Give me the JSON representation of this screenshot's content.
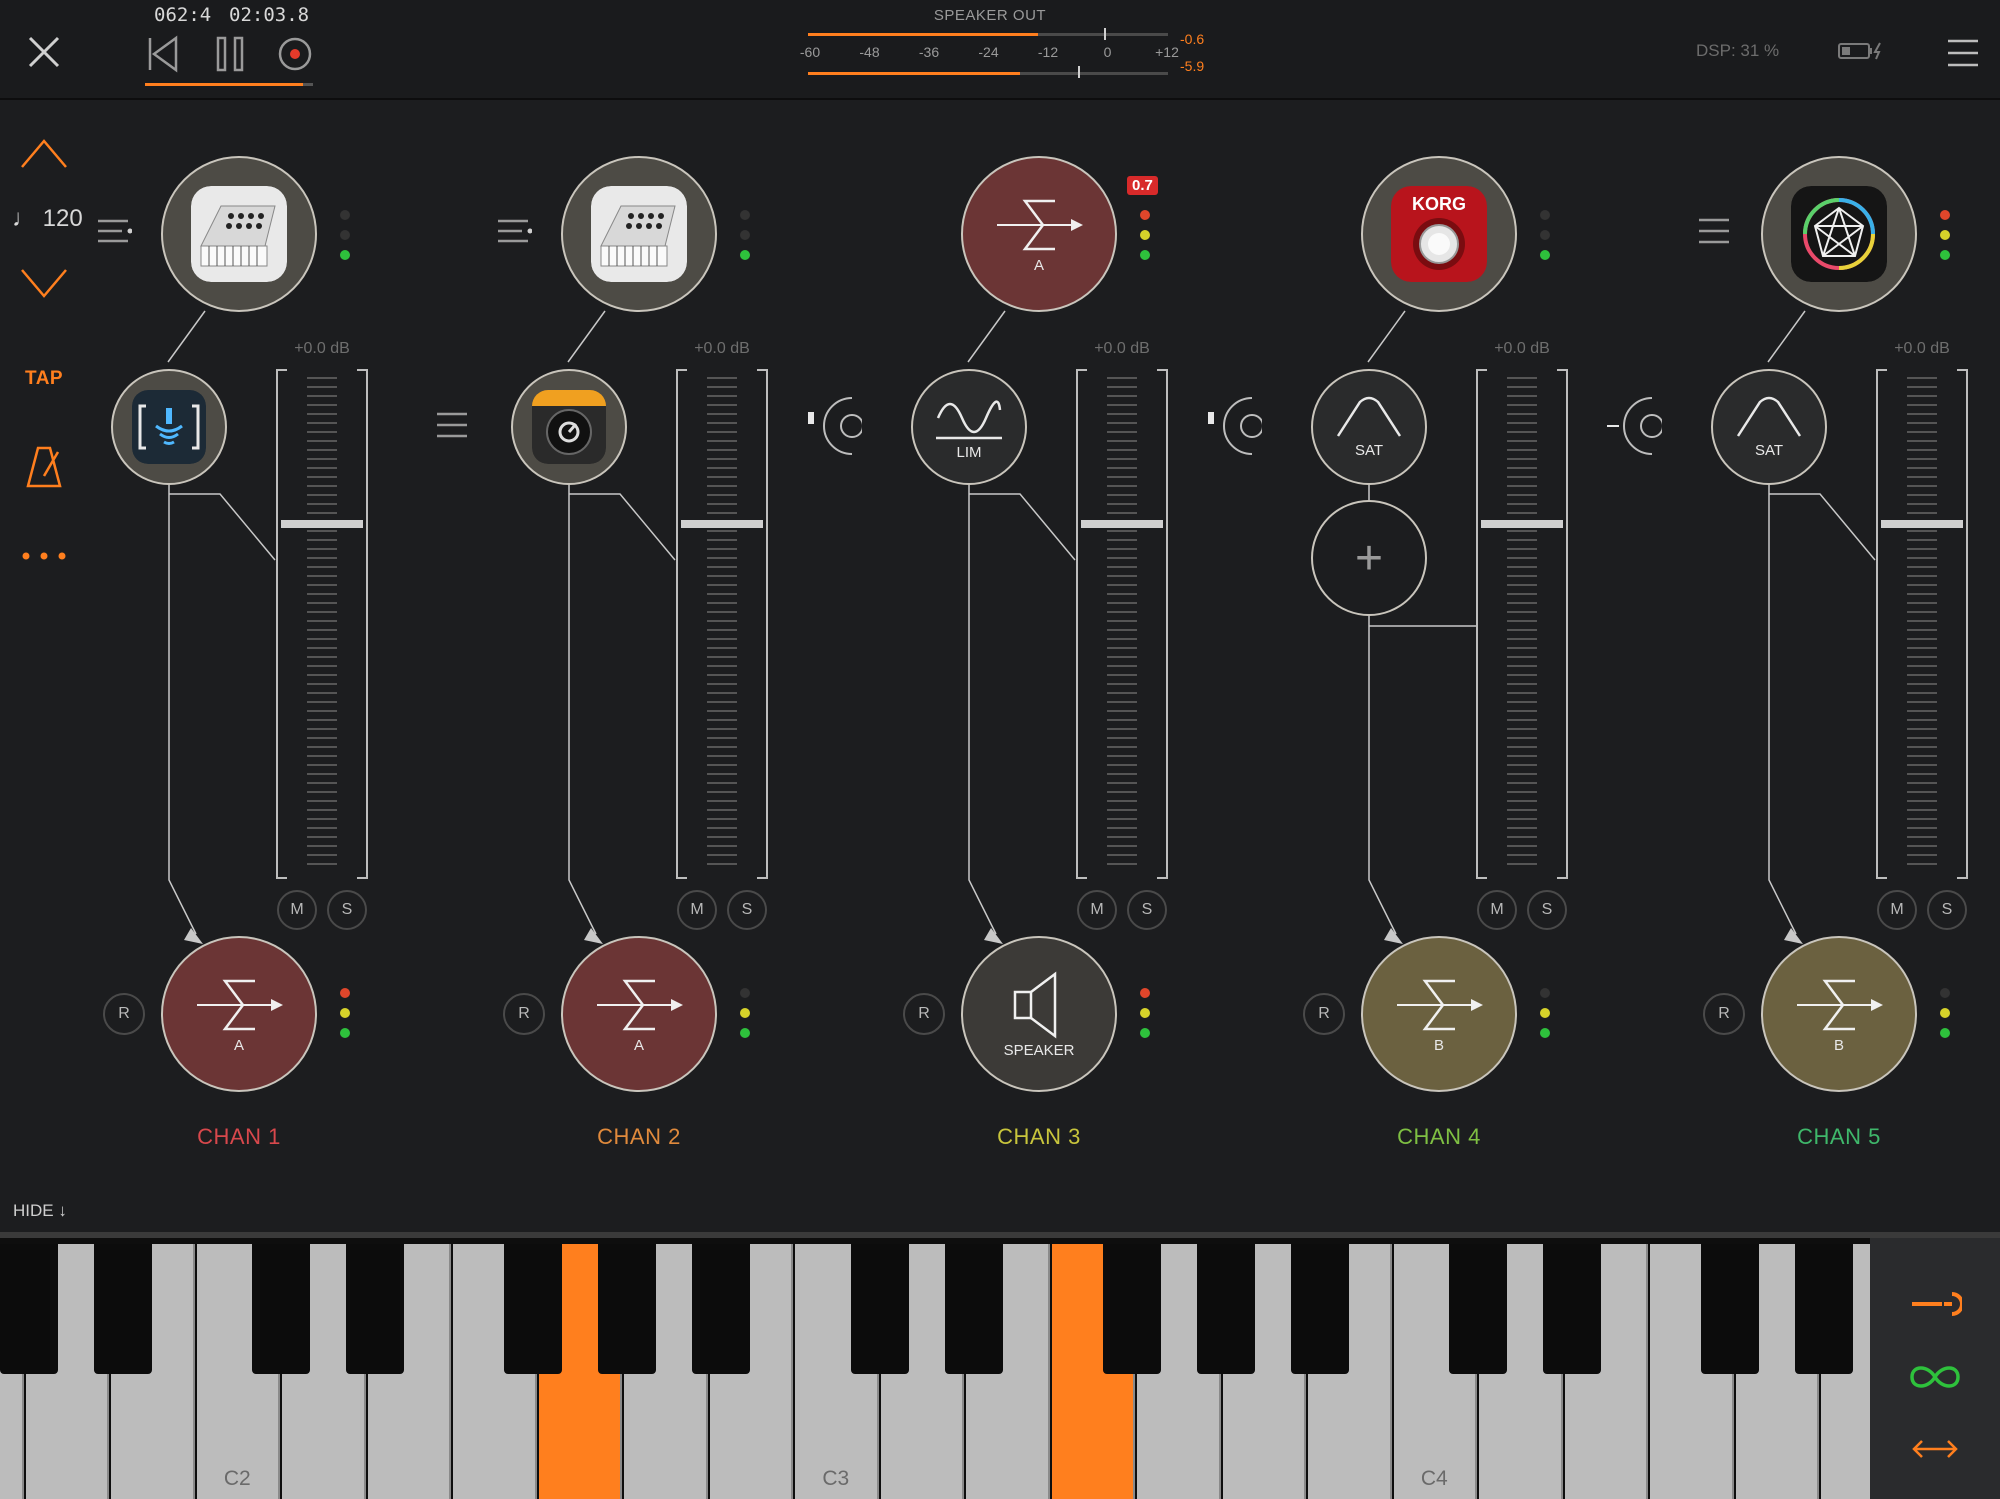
{
  "transport": {
    "position": "062:4",
    "time": "02:03.8"
  },
  "speaker_out": {
    "label": "SPEAKER OUT",
    "ticks": [
      "-60",
      "-48",
      "-36",
      "-24",
      "-12",
      "0",
      "+12"
    ],
    "peak_top": "-0.6",
    "peak_bottom": "-5.9",
    "level_top": 0.64,
    "level_bottom": 0.59
  },
  "dsp": "DSP: 31 %",
  "sidebar": {
    "tempo": "♩ 120",
    "tap": "TAP"
  },
  "hide_label": "HIDE ↓",
  "colors": {
    "accent": "#ff7f1e",
    "bus_a": "#6b3535",
    "bus_b": "#6b6140",
    "speaker": "#3c3a37",
    "node_fill": "#4d4b45",
    "led_red": "#e0462b",
    "led_yellow": "#d6d22a",
    "led_green": "#2ec13c"
  },
  "channels": [
    {
      "name": "CHAN 1",
      "color": "#d8484c",
      "source_icon": "synth-keyboard-icon",
      "fx": {
        "icon": "wave-bracket-icon",
        "label": ""
      },
      "db": "+0.0 dB",
      "bus": {
        "type": "sum",
        "label": "A"
      },
      "mute": "M",
      "solo": "S",
      "rec": "R"
    },
    {
      "name": "CHAN 2",
      "color": "#e08a3c",
      "source_icon": "synth-keyboard-icon",
      "fx": {
        "icon": "pedal-knob-icon",
        "label": ""
      },
      "db": "+0.0 dB",
      "bus": {
        "type": "sum",
        "label": "A"
      },
      "mute": "M",
      "solo": "S",
      "rec": "R"
    },
    {
      "name": "CHAN 3",
      "color": "#c8c53c",
      "source_icon": "sum-icon",
      "source_label": "A",
      "badge": "0.7",
      "fx": {
        "icon": "limiter-icon",
        "label": "LIM"
      },
      "db": "+0.0 dB",
      "bus": {
        "type": "speaker",
        "label": "SPEAKER"
      },
      "mute": "M",
      "solo": "S",
      "rec": "R"
    },
    {
      "name": "CHAN 4",
      "color": "#7fc043",
      "source_icon": "korg-knob-icon",
      "source_text": "KORG",
      "fx": {
        "icon": "saturation-icon",
        "label": "SAT"
      },
      "add": "+",
      "db": "+0.0 dB",
      "bus": {
        "type": "sum",
        "label": "B"
      },
      "mute": "M",
      "solo": "S",
      "rec": "R"
    },
    {
      "name": "CHAN 5",
      "color": "#3fb86b",
      "source_icon": "polygon-synth-icon",
      "fx": {
        "icon": "saturation-icon",
        "label": "SAT"
      },
      "db": "+0.0 dB",
      "bus": {
        "type": "sum",
        "label": "B"
      },
      "mute": "M",
      "solo": "S",
      "rec": "R"
    }
  ],
  "keyboard": {
    "labels": [
      "C2",
      "C3",
      "C4"
    ]
  }
}
